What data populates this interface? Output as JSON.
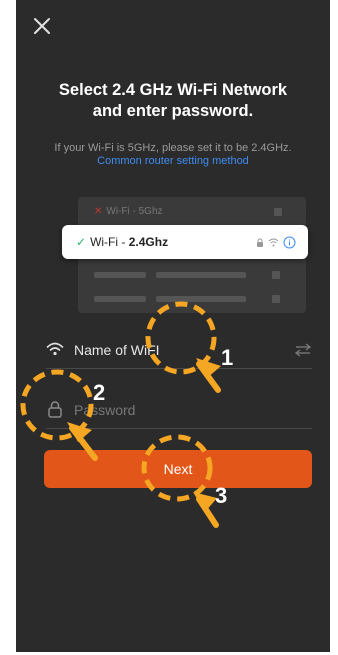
{
  "header": {
    "title_line1": "Select 2.4 GHz Wi-Fi Network",
    "title_line2": "and enter password.",
    "hint": "If your Wi-Fi is 5GHz, please set it to be 2.4GHz.",
    "help_link": "Common router setting method"
  },
  "illustration": {
    "bad_network": "Wi-Fi - 5Ghz",
    "good_prefix": "Wi-Fi - ",
    "good_band": "2.4Ghz"
  },
  "form": {
    "ssid_value": "Name of WiFI",
    "password_placeholder": "Password",
    "next_label": "Next"
  },
  "annotations": {
    "step1": "1",
    "step2": "2",
    "step3": "3"
  },
  "colors": {
    "background": "#2b2b2b",
    "accent": "#e2561a",
    "link": "#3f8cf0",
    "annotation": "#f5a623"
  },
  "icons": [
    "close-icon",
    "wifi-icon",
    "lock-icon",
    "switch-network-icon",
    "check-icon",
    "info-icon"
  ]
}
